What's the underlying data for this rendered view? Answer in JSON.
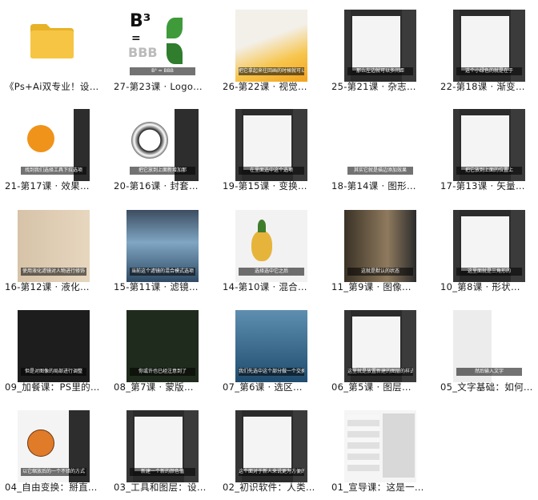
{
  "items": [
    {
      "name": "《Ps+Ai双专业！设…",
      "type": "folder",
      "caption": ""
    },
    {
      "name": "27-第23课 · Logo…",
      "type": "video",
      "caption": "B³ = BBB"
    },
    {
      "name": "26-第22课 · 视觉…",
      "type": "video",
      "caption": "把它拿起来往回画的时候就可以的曲线"
    },
    {
      "name": "25-第21课 · 杂志…",
      "type": "video",
      "caption": "那么左边就可以多间距"
    },
    {
      "name": "22-第18课 · 渐变…",
      "type": "video",
      "caption": "这个小绿色的就是在于"
    },
    {
      "name": "21-第17课 · 效果…",
      "type": "video",
      "caption": "找到我们选择工具下拉选项"
    },
    {
      "name": "20-第16课 · 封套…",
      "type": "video",
      "caption": "把它放到上面新增加那"
    },
    {
      "name": "19-第15课 · 变换…",
      "type": "video",
      "caption": "在里面选中这个选项"
    },
    {
      "name": "18-第14课 · 图形…",
      "type": "video",
      "caption": "其实它就是描边添加效果"
    },
    {
      "name": "17-第13课 · 矢量…",
      "type": "video",
      "caption": "把它放到上面的位置上"
    },
    {
      "name": "16-第12课 · 液化…",
      "type": "video",
      "caption": "使用液化滤镜对人物进行修饰"
    },
    {
      "name": "15-第11课 · 滤镜…",
      "type": "video",
      "caption": "当前这个滤镜的混合模式选项"
    },
    {
      "name": "14-第10课 · 混合…",
      "type": "video",
      "caption": "选择选中它之后"
    },
    {
      "name": "11_第9课 · 图像…",
      "type": "video",
      "caption": "这就是默认的状态"
    },
    {
      "name": "10_第8课 · 形状…",
      "type": "video",
      "caption": "这里面就是三角形的"
    },
    {
      "name": "09_加餐课：PS里的…",
      "type": "video",
      "caption": "但是对图像的局部进行调整"
    },
    {
      "name": "08_第7课 · 蒙版…",
      "type": "video",
      "caption": "你或许也已经注意到了"
    },
    {
      "name": "07_第6课 · 选区…",
      "type": "video",
      "caption": "我们先选中这个部分做一个交换"
    },
    {
      "name": "06_第5课 · 图层…",
      "type": "video",
      "caption": "这里就是放置新建的图层的样式"
    },
    {
      "name": "05_文字基础：如何…",
      "type": "video",
      "caption": "然后输入文字"
    },
    {
      "name": "04_自由变换：掰直…",
      "type": "video",
      "caption": "以它缩放后的一个不错的方式"
    },
    {
      "name": "03_工具和图层：设…",
      "type": "video",
      "caption": "新建一个新的颜色值"
    },
    {
      "name": "02_初识软件：人类…",
      "type": "video",
      "caption": "这个面对于新人来说更为方便的"
    },
    {
      "name": "01_宣导课：这是一…",
      "type": "video",
      "caption": ""
    }
  ],
  "colors": {
    "folder": "#f6c543",
    "folder_dark": "#e8b228",
    "orange": "#f0931a",
    "panel": "#2b2b2b"
  }
}
